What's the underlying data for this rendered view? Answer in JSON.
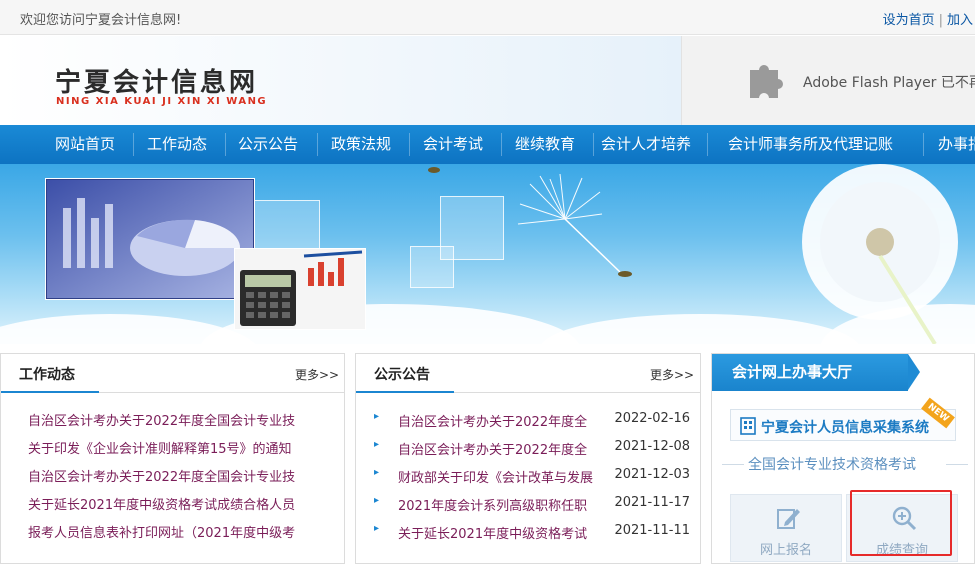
{
  "topbar": {
    "welcome": "欢迎您访问宁夏会计信息网!",
    "set_home": "设为首页",
    "add_fav": "加入"
  },
  "header": {
    "logo_cn": "宁夏会计信息网",
    "logo_en": "NING XIA KUAI JI XIN XI WANG",
    "flash_text": "Adobe Flash Player 已不再受"
  },
  "nav": {
    "items": [
      "网站首页",
      "工作动态",
      "公示公告",
      "政策法规",
      "会计考试",
      "继续教育",
      "会计人才培养",
      "会计师事务所及代理记账",
      "办事指"
    ]
  },
  "work_news": {
    "title": "工作动态",
    "more": "更多>>",
    "items": [
      "自治区会计考办关于2022年度全国会计专业技",
      "关于印发《企业会计准则解释第15号》的通知",
      "自治区会计考办关于2022年度全国会计专业技",
      "关于延长2021年度中级资格考试成绩合格人员",
      "报考人员信息表补打印网址（2021年度中级考"
    ]
  },
  "announcements": {
    "title": "公示公告",
    "more": "更多>>",
    "bullet": "▸",
    "items": [
      {
        "title": "自治区会计考办关于2022年度全",
        "date": "2022-02-16"
      },
      {
        "title": "自治区会计考办关于2022年度全",
        "date": "2021-12-08"
      },
      {
        "title": "财政部关于印发《会计改革与发展",
        "date": "2021-12-03"
      },
      {
        "title": "2021年度会计系列高级职称任职",
        "date": "2021-11-17"
      },
      {
        "title": "关于延长2021年度中级资格考试",
        "date": "2021-11-11"
      }
    ]
  },
  "service_hall": {
    "title": "会计网上办事大厅",
    "collect_label": "宁夏会计人员信息采集系统",
    "new_badge": "NEW",
    "exam_label": "全国会计专业技术资格考试",
    "register_label": "网上报名",
    "score_label": "成绩查询",
    "icons": [
      "building-icon",
      "edit-icon",
      "search-icon"
    ]
  },
  "colors": {
    "nav_bg": "#0d73c2",
    "link_purple": "#7a1d58",
    "accent_blue": "#1b86d1",
    "logo_red": "#d9301f",
    "highlight_red": "#e62a2a"
  }
}
